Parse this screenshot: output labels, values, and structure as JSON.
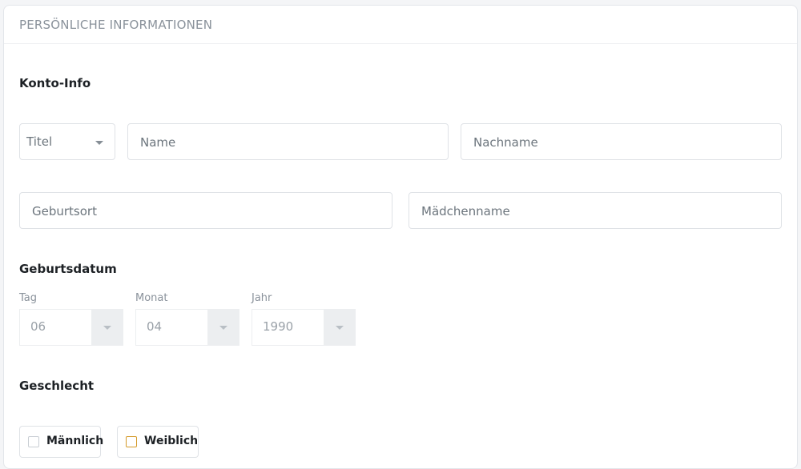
{
  "card": {
    "title": "PERSÖNLICHE INFORMATIONEN"
  },
  "account": {
    "section_title": "Konto-Info",
    "title_select": {
      "value": "Titel"
    },
    "name_placeholder": "Name",
    "lastname_placeholder": "Nachname",
    "birthplace_placeholder": "Geburtsort",
    "maidenname_placeholder": "Mädchenname"
  },
  "birthdate": {
    "section_title": "Geburtsdatum",
    "day": {
      "label": "Tag",
      "value": "06"
    },
    "month": {
      "label": "Monat",
      "value": "04"
    },
    "year": {
      "label": "Jahr",
      "value": "1990"
    }
  },
  "gender": {
    "section_title": "Geschlecht",
    "options": [
      {
        "label": "Männlich"
      },
      {
        "label": "Weiblich"
      }
    ]
  },
  "colors": {
    "accent_checkbox": "#d49a2a"
  }
}
